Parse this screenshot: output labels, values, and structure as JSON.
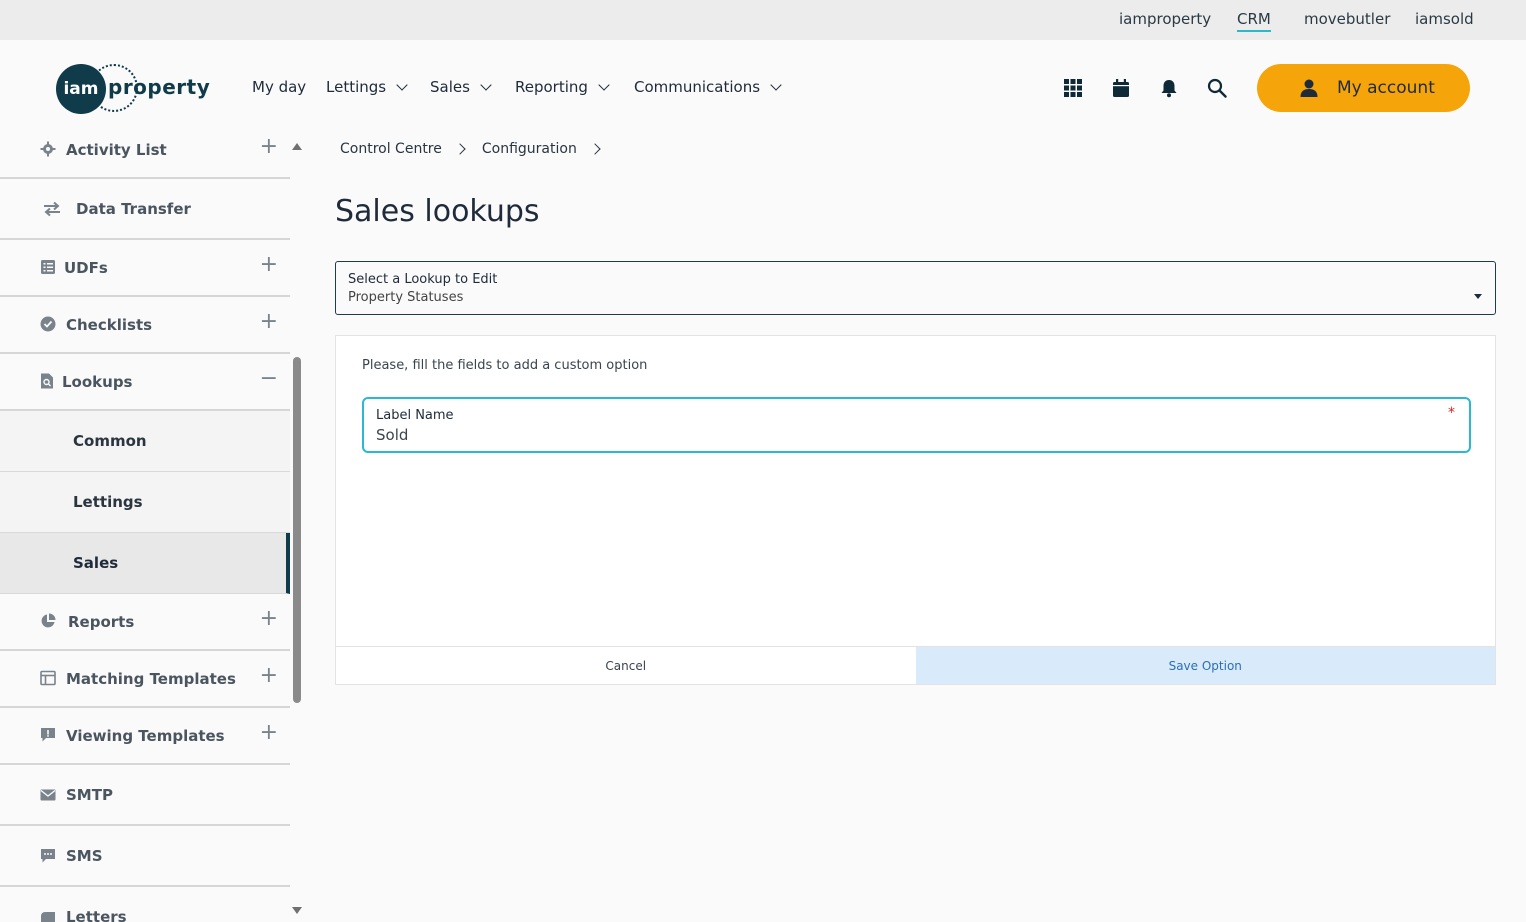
{
  "topbar": {
    "brands": [
      "iamproperty",
      "CRM",
      "movebutler",
      "iamsold"
    ],
    "active_brand": "CRM"
  },
  "header": {
    "logo": {
      "mark": "iam",
      "word": "property"
    },
    "nav": {
      "my_day": "My day",
      "lettings": "Lettings",
      "sales": "Sales",
      "reporting": "Reporting",
      "communications": "Communications"
    },
    "icons": [
      "apps-grid-icon",
      "calendar-icon",
      "bell-icon",
      "search-icon"
    ],
    "account_label": "My account",
    "accent_color": "#f5a50a"
  },
  "sidebar": {
    "activity_list": "Activity List",
    "data_transfer": "Data Transfer",
    "udfs": "UDFs",
    "checklists": "Checklists",
    "lookups": "Lookups",
    "lookups_children": {
      "common": "Common",
      "lettings": "Lettings",
      "sales": "Sales"
    },
    "reports": "Reports",
    "matching_templates": "Matching Templates",
    "viewing_templates": "Viewing Templates",
    "smtp": "SMTP",
    "sms": "SMS",
    "letters": "Letters",
    "selected": "Sales"
  },
  "main": {
    "breadcrumb": [
      "Control Centre",
      "Configuration"
    ],
    "title": "Sales lookups",
    "lookup_select": {
      "label": "Select a Lookup to Edit",
      "value": "Property Statuses"
    },
    "form": {
      "hint": "Please, fill the fields to add a custom option",
      "label_name": {
        "label": "Label Name",
        "value": "Sold",
        "required_mark": "*"
      },
      "cancel": "Cancel",
      "save": "Save Option"
    }
  }
}
